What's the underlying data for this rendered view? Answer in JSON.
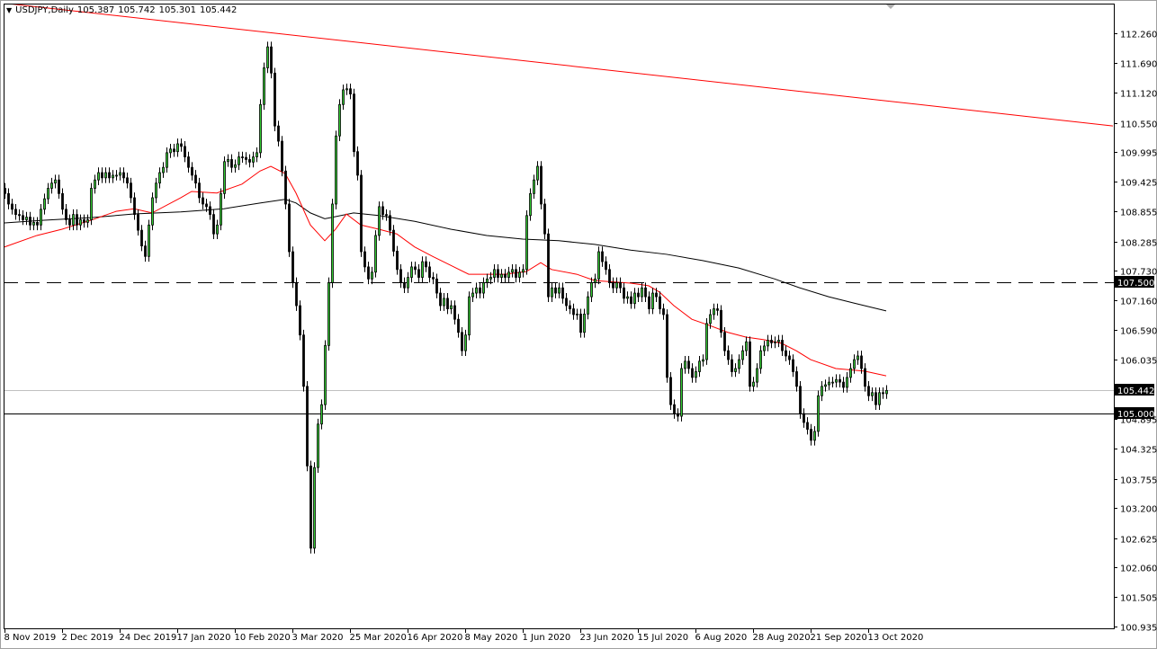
{
  "header": {
    "symbol": "USDJPY,Daily",
    "open": "105.387",
    "high": "105.742",
    "low": "105.301",
    "close": "105.442"
  },
  "colors": {
    "bull": "#33cc33",
    "bear": "#000000",
    "ma_fast": "#ff0000",
    "ma_slow": "#000000",
    "trendline": "#ff0000",
    "current_line": "#c0c0c0"
  },
  "chart_data": {
    "type": "candlestick",
    "title": "USDJPY,Daily",
    "ylim": [
      100.935,
      112.26
    ],
    "yticks": [
      "112.260",
      "111.690",
      "111.120",
      "110.550",
      "109.995",
      "109.425",
      "108.855",
      "108.285",
      "107.730",
      "107.160",
      "106.590",
      "106.035",
      "104.895",
      "104.325",
      "103.755",
      "103.200",
      "102.625",
      "102.060",
      "101.505",
      "100.935"
    ],
    "xticks": [
      {
        "bar": 0,
        "label": "8 Nov 2019"
      },
      {
        "bar": 16,
        "label": "2 Dec 2019"
      },
      {
        "bar": 32,
        "label": "24 Dec 2019"
      },
      {
        "bar": 48,
        "label": "17 Jan 2020"
      },
      {
        "bar": 64,
        "label": "10 Feb 2020"
      },
      {
        "bar": 80,
        "label": "3 Mar 2020"
      },
      {
        "bar": 96,
        "label": "25 Mar 2020"
      },
      {
        "bar": 112,
        "label": "16 Apr 2020"
      },
      {
        "bar": 128,
        "label": "8 May 2020"
      },
      {
        "bar": 144,
        "label": "1 Jun 2020"
      },
      {
        "bar": 160,
        "label": "23 Jun 2020"
      },
      {
        "bar": 176,
        "label": "15 Jul 2020"
      },
      {
        "bar": 192,
        "label": "6 Aug 2020"
      },
      {
        "bar": 208,
        "label": "28 Aug 2020"
      },
      {
        "bar": 224,
        "label": "21 Sep 2020"
      },
      {
        "bar": 240,
        "label": "13 Oct 2020"
      }
    ],
    "closes": [
      109.2,
      109.0,
      108.9,
      108.8,
      108.78,
      108.7,
      108.75,
      108.6,
      108.65,
      108.6,
      108.9,
      109.1,
      109.3,
      109.4,
      109.46,
      109.2,
      108.9,
      108.7,
      108.6,
      108.8,
      108.6,
      108.7,
      108.65,
      108.7,
      109.3,
      109.46,
      109.6,
      109.5,
      109.6,
      109.5,
      109.55,
      109.55,
      109.6,
      109.5,
      109.4,
      109.12,
      108.8,
      108.5,
      108.2,
      108.0,
      108.6,
      109.12,
      109.4,
      109.6,
      109.7,
      109.98,
      110.05,
      110.0,
      110.15,
      110.1,
      109.9,
      109.7,
      109.55,
      109.4,
      109.12,
      109.0,
      108.95,
      108.8,
      108.43,
      108.6,
      109.2,
      109.81,
      109.85,
      109.7,
      109.75,
      109.9,
      109.89,
      109.85,
      109.8,
      109.9,
      109.98,
      110.9,
      111.6,
      112.0,
      111.5,
      110.49,
      110.2,
      109.63,
      109.0,
      108.09,
      107.5,
      107.06,
      106.5,
      105.52,
      104.0,
      102.43,
      103.97,
      104.8,
      105.17,
      106.3,
      107.5,
      109.0,
      110.3,
      110.9,
      111.18,
      111.2,
      111.1,
      110.0,
      109.55,
      108.09,
      107.8,
      107.57,
      107.7,
      108.4,
      108.95,
      108.8,
      108.78,
      108.5,
      108.1,
      107.75,
      107.5,
      107.4,
      107.6,
      107.8,
      107.75,
      107.6,
      107.9,
      107.8,
      107.6,
      107.57,
      107.3,
      107.06,
      107.2,
      107.0,
      107.06,
      106.8,
      106.55,
      106.2,
      106.5,
      107.23,
      107.3,
      107.4,
      107.3,
      107.5,
      107.57,
      107.6,
      107.75,
      107.6,
      107.66,
      107.6,
      107.7,
      107.75,
      107.6,
      107.7,
      107.75,
      108.78,
      109.2,
      109.46,
      109.72,
      109.0,
      108.43,
      107.23,
      107.4,
      107.3,
      107.4,
      107.2,
      107.06,
      107.0,
      106.89,
      106.9,
      106.55,
      106.9,
      107.23,
      107.5,
      107.57,
      108.09,
      107.9,
      107.75,
      107.5,
      107.4,
      107.5,
      107.4,
      107.2,
      107.23,
      107.1,
      107.3,
      107.23,
      107.4,
      107.23,
      107.0,
      107.3,
      107.23,
      107.0,
      106.89,
      105.69,
      105.17,
      105.0,
      104.95,
      105.86,
      106.0,
      105.86,
      105.69,
      105.8,
      106.0,
      106.03,
      106.72,
      106.89,
      107.0,
      106.97,
      106.55,
      106.2,
      106.03,
      105.8,
      105.86,
      106.03,
      106.2,
      106.37,
      105.52,
      105.6,
      105.86,
      106.2,
      106.29,
      106.4,
      106.35,
      106.37,
      106.4,
      106.2,
      106.1,
      106.03,
      105.8,
      105.52,
      105.0,
      104.83,
      104.7,
      104.49,
      104.66,
      105.34,
      105.52,
      105.55,
      105.6,
      105.6,
      105.65,
      105.6,
      105.5,
      105.69,
      105.86,
      106.03,
      106.1,
      105.86,
      105.52,
      105.34,
      105.4,
      105.17,
      105.4,
      105.38,
      105.442
    ],
    "ma_fast": [
      [
        0,
        108.18
      ],
      [
        9,
        108.4
      ],
      [
        16,
        108.52
      ],
      [
        24,
        108.69
      ],
      [
        31,
        108.86
      ],
      [
        36,
        108.91
      ],
      [
        41,
        108.83
      ],
      [
        49,
        109.12
      ],
      [
        52,
        109.24
      ],
      [
        59,
        109.21
      ],
      [
        66,
        109.38
      ],
      [
        71,
        109.63
      ],
      [
        74,
        109.72
      ],
      [
        78,
        109.58
      ],
      [
        81,
        109.21
      ],
      [
        85,
        108.6
      ],
      [
        89,
        108.3
      ],
      [
        92,
        108.52
      ],
      [
        95,
        108.81
      ],
      [
        99,
        108.6
      ],
      [
        104,
        108.52
      ],
      [
        109,
        108.43
      ],
      [
        114,
        108.18
      ],
      [
        119,
        108.0
      ],
      [
        124,
        107.83
      ],
      [
        129,
        107.66
      ],
      [
        134,
        107.66
      ],
      [
        139,
        107.66
      ],
      [
        145,
        107.71
      ],
      [
        149,
        107.88
      ],
      [
        152,
        107.75
      ],
      [
        159,
        107.66
      ],
      [
        164,
        107.54
      ],
      [
        174,
        107.49
      ],
      [
        179,
        107.44
      ],
      [
        182,
        107.32
      ],
      [
        186,
        107.06
      ],
      [
        191,
        106.8
      ],
      [
        196,
        106.68
      ],
      [
        201,
        106.55
      ],
      [
        206,
        106.46
      ],
      [
        211,
        106.41
      ],
      [
        216,
        106.34
      ],
      [
        220,
        106.2
      ],
      [
        224,
        106.03
      ],
      [
        231,
        105.86
      ],
      [
        239,
        105.81
      ],
      [
        245,
        105.72
      ]
    ],
    "ma_slow": [
      [
        0,
        108.64
      ],
      [
        11,
        108.69
      ],
      [
        24,
        108.74
      ],
      [
        36,
        108.81
      ],
      [
        49,
        108.85
      ],
      [
        61,
        108.91
      ],
      [
        71,
        109.02
      ],
      [
        78,
        109.09
      ],
      [
        81,
        109.02
      ],
      [
        85,
        108.83
      ],
      [
        89,
        108.72
      ],
      [
        92,
        108.76
      ],
      [
        97,
        108.83
      ],
      [
        104,
        108.78
      ],
      [
        114,
        108.67
      ],
      [
        124,
        108.52
      ],
      [
        134,
        108.4
      ],
      [
        144,
        108.33
      ],
      [
        154,
        108.3
      ],
      [
        164,
        108.23
      ],
      [
        174,
        108.12
      ],
      [
        184,
        108.04
      ],
      [
        194,
        107.92
      ],
      [
        204,
        107.78
      ],
      [
        214,
        107.57
      ],
      [
        221,
        107.4
      ],
      [
        229,
        107.23
      ],
      [
        236,
        107.11
      ],
      [
        245,
        106.96
      ]
    ],
    "trendline": [
      [
        -1,
        112.84
      ],
      [
        308,
        110.49
      ]
    ],
    "levels": [
      {
        "price": 107.5,
        "label": "107.500",
        "style": "dashed"
      },
      {
        "price": 105.0,
        "label": "105.000",
        "style": "solid"
      },
      {
        "price": 105.442,
        "label": "105.442",
        "style": "current"
      }
    ]
  }
}
